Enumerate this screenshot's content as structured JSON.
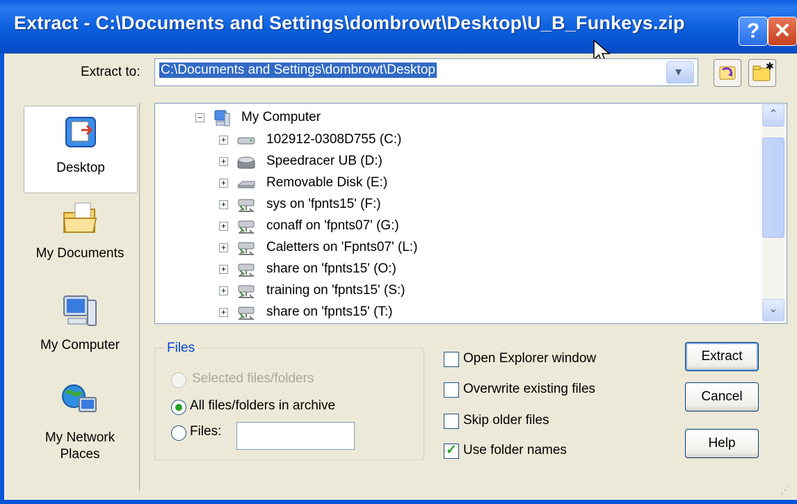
{
  "window": {
    "title": "Extract - C:\\Documents and Settings\\dombrowt\\Desktop\\U_B_Funkeys.zip",
    "help_label": "?",
    "close_label": "✕"
  },
  "extract_to": {
    "label": "Extract to:",
    "value": "C:\\Documents and Settings\\dombrowt\\Desktop"
  },
  "places": [
    {
      "label": "Desktop",
      "icon": "desktop-icon",
      "selected": true
    },
    {
      "label": "My Documents",
      "icon": "my-documents-icon"
    },
    {
      "label": "My Computer",
      "icon": "my-computer-icon"
    },
    {
      "label": "My Network Places",
      "icon": "network-places-icon"
    }
  ],
  "tree": {
    "root": {
      "label": "My Computer",
      "expander": "−",
      "icon": "computer-icon"
    },
    "items": [
      {
        "label": "102912-0308D755 (C:)",
        "icon": "hard-drive-icon"
      },
      {
        "label": "Speedracer UB (D:)",
        "icon": "cd-drive-icon"
      },
      {
        "label": "Removable Disk (E:)",
        "icon": "removable-disk-icon"
      },
      {
        "label": "sys on 'fpnts15' (F:)",
        "icon": "network-drive-icon"
      },
      {
        "label": "conaff on 'fpnts07' (G:)",
        "icon": "network-drive-icon"
      },
      {
        "label": "Caletters on 'Fpnts07' (L:)",
        "icon": "network-drive-icon"
      },
      {
        "label": "share on 'fpnts15' (O:)",
        "icon": "network-drive-icon"
      },
      {
        "label": "training on 'fpnts15' (S:)",
        "icon": "network-drive-icon"
      },
      {
        "label": "share on 'fpnts15' (T:)",
        "icon": "network-drive-icon"
      }
    ],
    "expander_plus": "+"
  },
  "files_group": {
    "title": "Files",
    "selected_label": "Selected files/folders",
    "all_label": "All files/folders in archive",
    "files_label": "Files:",
    "files_value": ""
  },
  "options": {
    "open_explorer": "Open Explorer window",
    "overwrite": "Overwrite existing files",
    "skip_older": "Skip older files",
    "use_folder_names": "Use folder names"
  },
  "buttons": {
    "extract": "Extract",
    "cancel": "Cancel",
    "help": "Help"
  },
  "colors": {
    "title_bar": "#0a5fdc",
    "selection": "#316ac5",
    "group_title": "#0046d5",
    "check_mark": "#21a121"
  }
}
